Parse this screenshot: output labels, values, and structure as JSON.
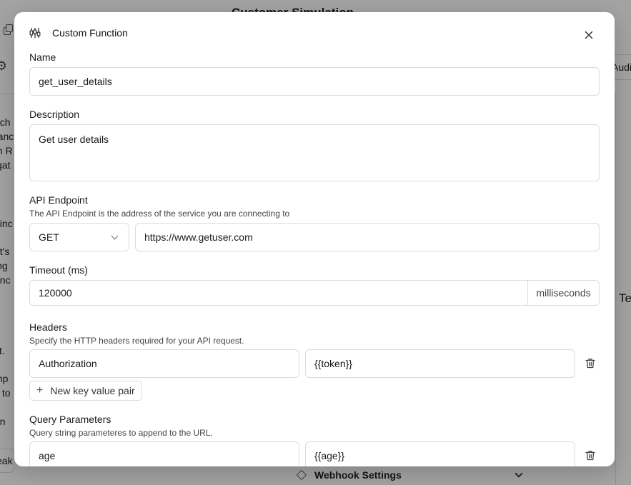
{
  "background": {
    "title": "Customer Simulation",
    "settings_icon": "⚙",
    "left_text_1": [
      "ach",
      "ranc",
      "th R",
      "igat"
    ],
    "left_text_2": [
      "ainc"
    ],
    "left_text_3": [
      "nt's",
      "ing",
      "unc"
    ],
    "left_text_4": [
      "ct."
    ],
    "left_text_5": [
      "mp",
      "x to"
    ],
    "left_text_6": [
      "on"
    ],
    "left_button": "eak",
    "right_tab": "Audio",
    "right_text": "Te",
    "webhook_label": "Webhook Settings"
  },
  "modal": {
    "title": "Custom Function",
    "name": {
      "label": "Name",
      "value": "get_user_details"
    },
    "description": {
      "label": "Description",
      "value": "Get user details"
    },
    "api_endpoint": {
      "label": "API Endpoint",
      "hint": "The API Endpoint is the address of the service you are connecting to",
      "method": "GET",
      "url": "https://www.getuser.com"
    },
    "timeout": {
      "label": "Timeout (ms)",
      "value": "120000",
      "unit": "milliseconds"
    },
    "headers": {
      "label": "Headers",
      "hint": "Specify the HTTP headers required for your API request.",
      "rows": [
        {
          "key": "Authorization",
          "value": "{{token}}"
        }
      ],
      "add_label": "New key value pair"
    },
    "query_params": {
      "label": "Query Parameters",
      "hint": "Query string parameteres to append to the URL.",
      "rows": [
        {
          "key": "age",
          "value": "{{age}}"
        }
      ]
    }
  },
  "colors": {
    "overlay": "#5c5c5c",
    "border": "#dcdcdc",
    "text": "#1a1a1a"
  }
}
